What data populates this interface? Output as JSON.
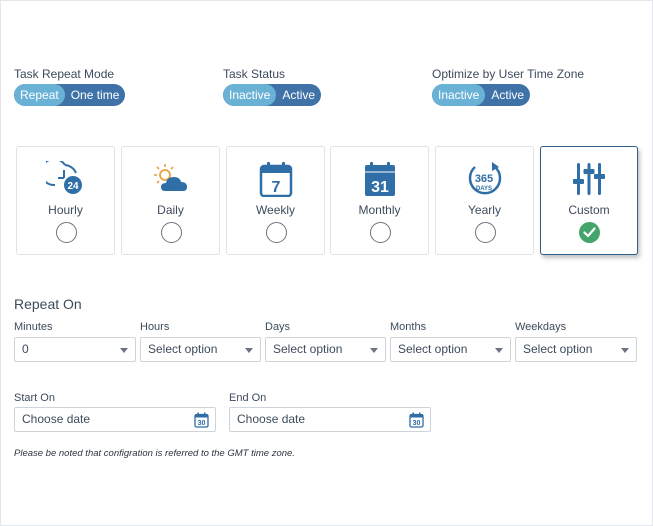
{
  "toggles": [
    {
      "label": "Task Repeat Mode",
      "options": [
        "Repeat",
        "One time"
      ],
      "selected": 0
    },
    {
      "label": "Task Status",
      "options": [
        "Inactive",
        "Active"
      ],
      "selected": 0
    },
    {
      "label": "Optimize by User Time Zone",
      "options": [
        "Inactive",
        "Active"
      ],
      "selected": 0
    }
  ],
  "frequency_cards": [
    {
      "label": "Hourly",
      "icon": "hourly-clock-24-icon",
      "icon_text": "24",
      "selected": false
    },
    {
      "label": "Daily",
      "icon": "sun-cloud-icon",
      "selected": false
    },
    {
      "label": "Weekly",
      "icon": "calendar-7-icon",
      "icon_text": "7",
      "selected": false
    },
    {
      "label": "Monthly",
      "icon": "calendar-31-icon",
      "icon_text": "31",
      "selected": false
    },
    {
      "label": "Yearly",
      "icon": "365-days-icon",
      "icon_text": "365",
      "icon_subtext": "DAYS",
      "selected": false
    },
    {
      "label": "Custom",
      "icon": "sliders-icon",
      "selected": true
    }
  ],
  "repeat_on": {
    "title": "Repeat On",
    "fields": [
      {
        "label": "Minutes",
        "value": "0"
      },
      {
        "label": "Hours",
        "value": "Select option"
      },
      {
        "label": "Days",
        "value": "Select option"
      },
      {
        "label": "Months",
        "value": "Select option"
      },
      {
        "label": "Weekdays",
        "value": "Select option"
      }
    ]
  },
  "dates": {
    "start": {
      "label": "Start On",
      "placeholder": "Choose date",
      "icon_text": "30"
    },
    "end": {
      "label": "End On",
      "placeholder": "Choose date",
      "icon_text": "30"
    }
  },
  "note": "Please be noted that configration is referred to the GMT time zone.",
  "colors": {
    "toggle_bg": "#3f73a8",
    "toggle_active": "#6ab1d6",
    "icon_blue": "#2f6ea6",
    "check_green": "#43a56b",
    "selected_border": "#2f5f8a"
  }
}
